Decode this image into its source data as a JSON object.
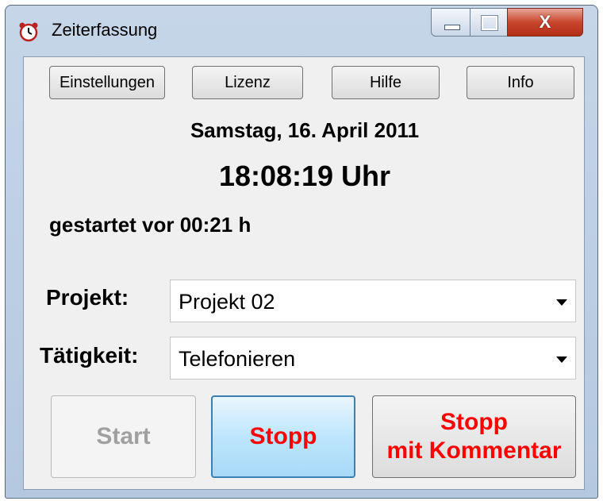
{
  "window": {
    "title": "Zeiterfassung",
    "close_glyph": "X",
    "icons": {
      "app": "alarm-clock-icon"
    }
  },
  "toolbar": {
    "settings": "Einstellungen",
    "license": "Lizenz",
    "help": "Hilfe",
    "info": "Info"
  },
  "status": {
    "date": "Samstag, 16. April 2011",
    "time": "18:08:19 Uhr",
    "started": "gestartet vor 00:21 h"
  },
  "form": {
    "project_label": "Projekt:",
    "project_value": "Projekt 02",
    "activity_label": "Tätigkeit:",
    "activity_value": "Telefonieren"
  },
  "actions": {
    "start": "Start",
    "stop": "Stopp",
    "stop_comment_line1": "Stopp",
    "stop_comment_line2": "mit Kommentar",
    "start_enabled": false
  },
  "colors": {
    "accent_red": "#ff0000",
    "disabled_text": "#a0a0a0",
    "focus_border": "#3c7fb1"
  }
}
